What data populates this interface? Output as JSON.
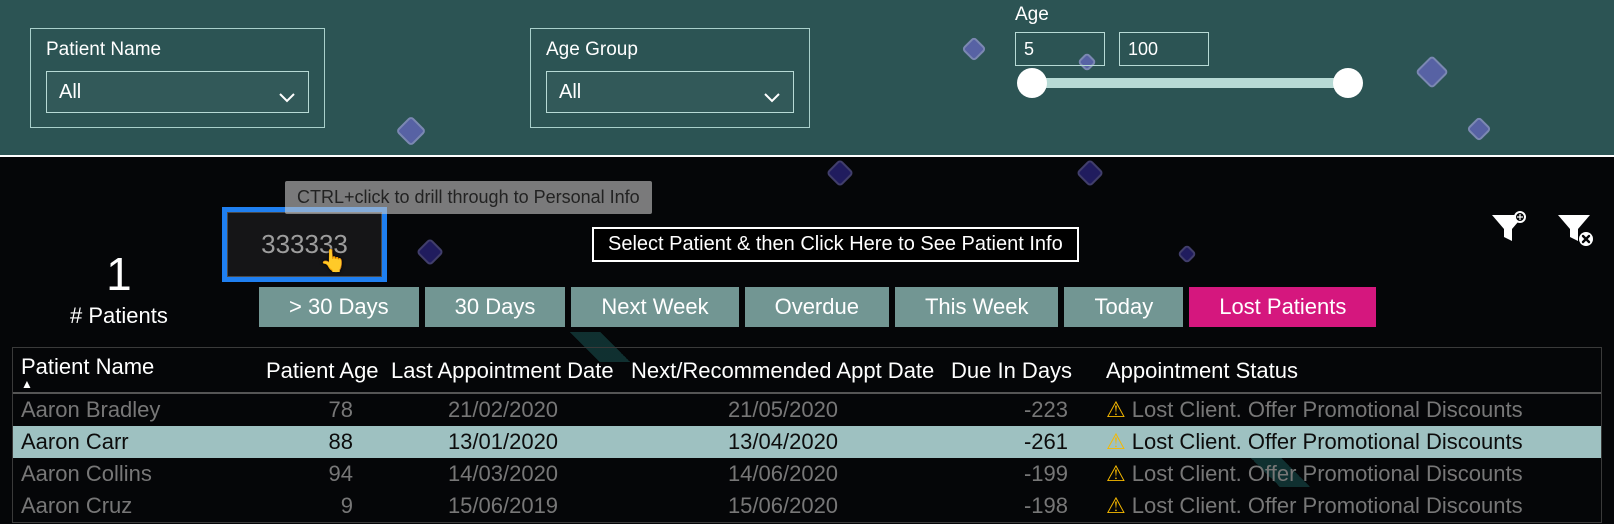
{
  "filters": {
    "patient_name": {
      "label": "Patient Name",
      "value": "All"
    },
    "age_group": {
      "label": "Age Group",
      "value": "All"
    },
    "age": {
      "label": "Age",
      "min": "5",
      "max": "100"
    }
  },
  "tooltip": "CTRL+click to drill through to Personal Info",
  "drill_value": "333333",
  "info_link": "Select Patient & then Click Here to See Patient Info",
  "kpi": {
    "value": "1",
    "label": "# Patients"
  },
  "bookmarks": {
    "b0": "> 30 Days",
    "b1": "30 Days",
    "b2": "Next Week",
    "b3": "Overdue",
    "b4": "This Week",
    "b5": "Today",
    "b6": "Lost Patients"
  },
  "table": {
    "headers": {
      "name": "Patient Name",
      "age": "Patient Age",
      "last": "Last Appointment Date",
      "next": "Next/Recommended Appt Date",
      "due": "Due In Days",
      "status": "Appointment Status"
    },
    "rows": [
      {
        "name": "Aaron Bradley",
        "age": "78",
        "last": "21/02/2020",
        "next": "21/05/2020",
        "due": "-223",
        "status": "Lost Client. Offer Promotional Discounts",
        "selected": false
      },
      {
        "name": "Aaron Carr",
        "age": "88",
        "last": "13/01/2020",
        "next": "13/04/2020",
        "due": "-261",
        "status": "Lost Client. Offer Promotional Discounts",
        "selected": true
      },
      {
        "name": "Aaron Collins",
        "age": "94",
        "last": "14/03/2020",
        "next": "14/06/2020",
        "due": "-199",
        "status": "Lost Client. Offer Promotional Discounts",
        "selected": false
      },
      {
        "name": "Aaron Cruz",
        "age": "9",
        "last": "15/06/2019",
        "next": "15/06/2020",
        "due": "-198",
        "status": "Lost Client. Offer Promotional Discounts",
        "selected": false
      }
    ]
  }
}
